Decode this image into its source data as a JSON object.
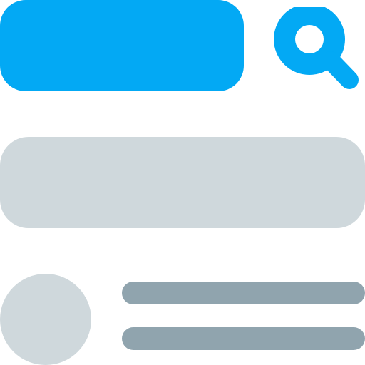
{
  "colors": {
    "accent": "#03A9F4",
    "placeholder_light": "#CFD8DC",
    "placeholder_dark": "#90A4AE"
  },
  "search": {
    "icon": "search-icon"
  },
  "content": {
    "banner": "placeholder-block",
    "list_item": {
      "avatar": "avatar-placeholder",
      "lines": [
        "text-line",
        "text-line"
      ]
    }
  }
}
